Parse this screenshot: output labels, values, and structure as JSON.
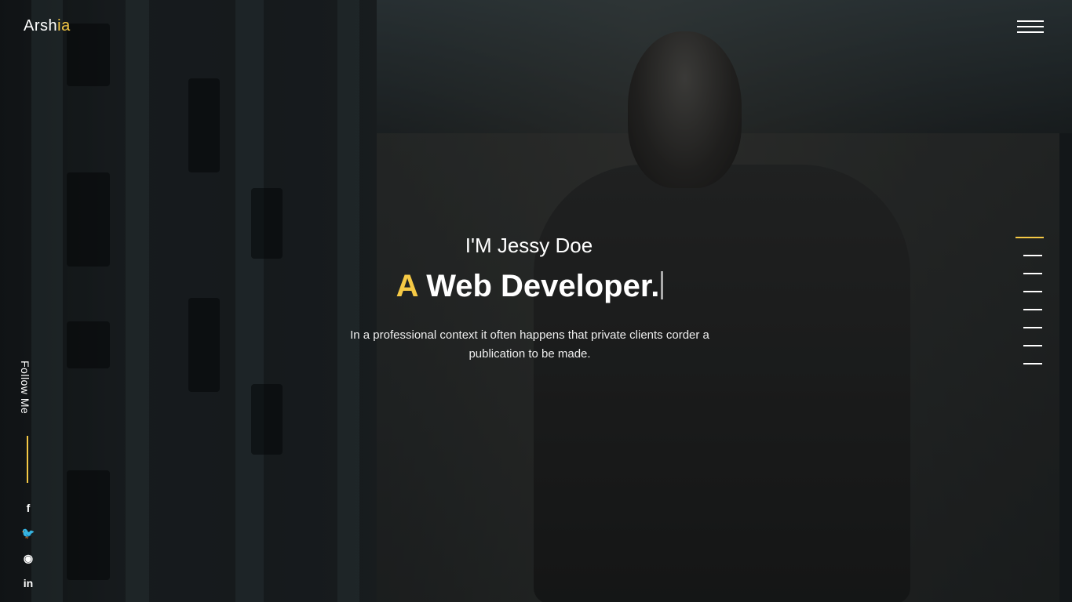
{
  "brand": {
    "name_main": "Arsh",
    "name_accent": "ia"
  },
  "hero": {
    "intro": "I'M Jessy Doe",
    "role_accent": "A",
    "role_rest": "Web Developer.",
    "description": "In a professional context it often happens that private clients corder a publication to be made."
  },
  "follow": {
    "label": "Follow Me"
  },
  "social": [
    {
      "icon": "facebook-icon",
      "glyph": "f"
    },
    {
      "icon": "twitter-icon",
      "glyph": "🐦"
    },
    {
      "icon": "github-icon",
      "glyph": "◉"
    },
    {
      "icon": "linkedin-icon",
      "glyph": "in"
    }
  ],
  "section_nav": {
    "count": 8,
    "active_index": 0
  },
  "colors": {
    "accent": "#f5c945",
    "text": "#ffffff"
  }
}
